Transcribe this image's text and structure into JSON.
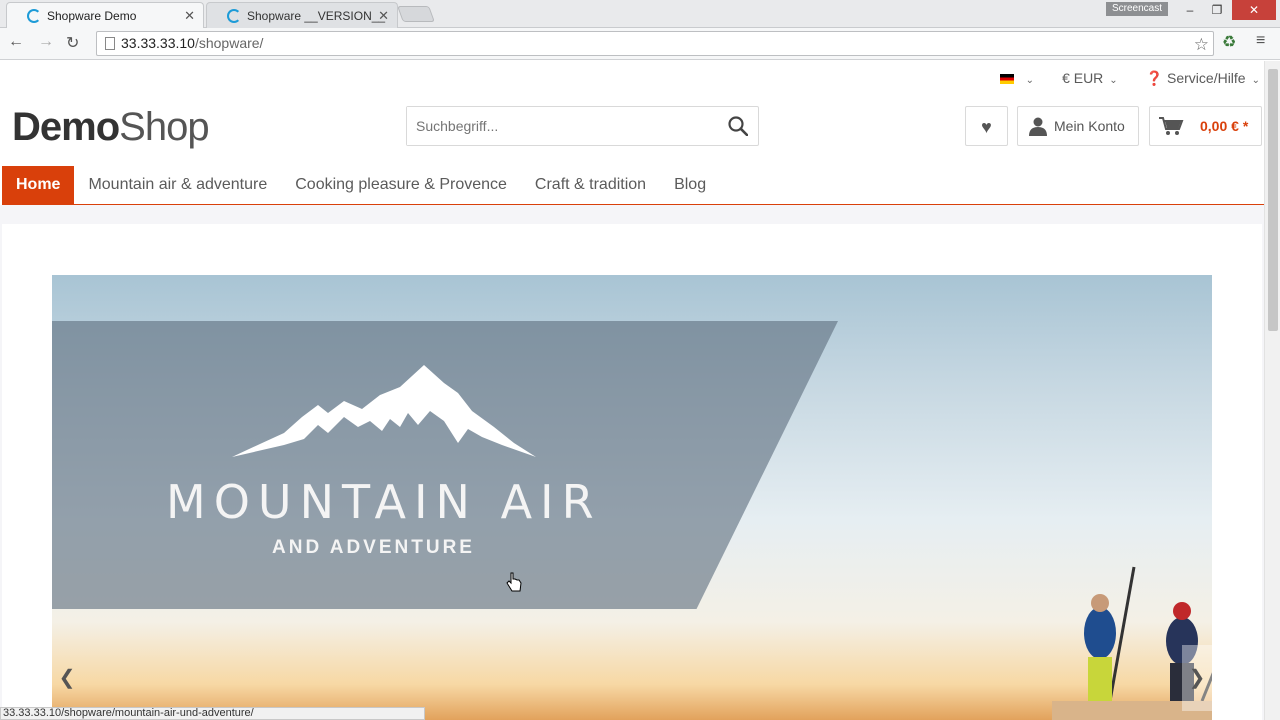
{
  "browser": {
    "tabs": [
      {
        "title": "Shopware Demo"
      },
      {
        "title": "Shopware __VERSION__"
      }
    ],
    "screencast_label": "Screencast",
    "url_host": "33.33.33.10",
    "url_path": "/shopware/",
    "status_url": "33.33.33.10/shopware/mountain-air-und-adventure/"
  },
  "shop": {
    "top": {
      "currency": "€ EUR",
      "service": "Service/Hilfe"
    },
    "logo_bold": "Demo",
    "logo_light": "Shop",
    "search_placeholder": "Suchbegriff...",
    "account_label": "Mein Konto",
    "cart_total": "0,00 € *",
    "nav": [
      {
        "label": "Home"
      },
      {
        "label": "Mountain air & adventure"
      },
      {
        "label": "Cooking pleasure & Provence"
      },
      {
        "label": "Craft & tradition"
      },
      {
        "label": "Blog"
      }
    ],
    "hero": {
      "title": "MOUNTAIN AIR",
      "subtitle": "AND ADVENTURE"
    }
  },
  "icons": [
    "search-icon",
    "heart-icon",
    "user-icon",
    "cart-icon",
    "star-icon",
    "chevron-left-icon",
    "chevron-right-icon",
    "flag-de-icon"
  ]
}
